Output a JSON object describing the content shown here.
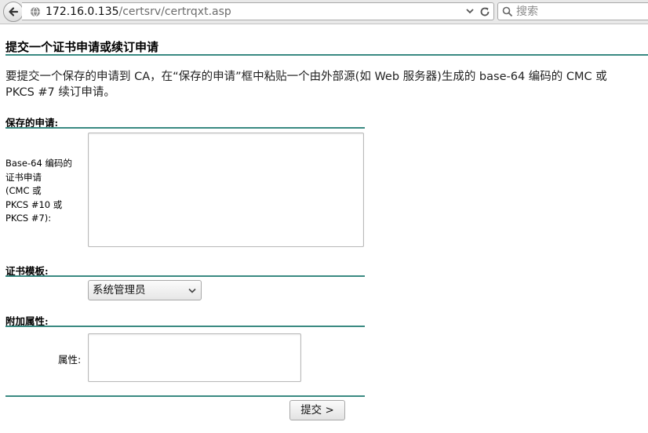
{
  "browser": {
    "url_host": "172.16.0.135",
    "url_path": "/certsrv/certrqxt.asp",
    "search_placeholder": "搜索"
  },
  "page": {
    "title": "提交一个证书申请或续订申请",
    "intro_line1": "要提交一个保存的申请到 CA，在“保存的申请”框中粘贴一个由外部源(如 Web 服务器)生成的 base-64 编码的 CMC 或",
    "intro_line2": "PKCS #7 续订申请。",
    "accent_color": "#3a8a82"
  },
  "saved_request": {
    "heading": "保存的申请:",
    "field_label": "Base-64 编码的\n证书申请\n(CMC 或\nPKCS #10 或\nPKCS #7):"
  },
  "cert_template": {
    "heading": "证书模板:",
    "selected": "系统管理员"
  },
  "extra_attributes": {
    "heading": "附加属性:",
    "field_label": "属性:"
  },
  "submit": {
    "label": "提交 >"
  }
}
